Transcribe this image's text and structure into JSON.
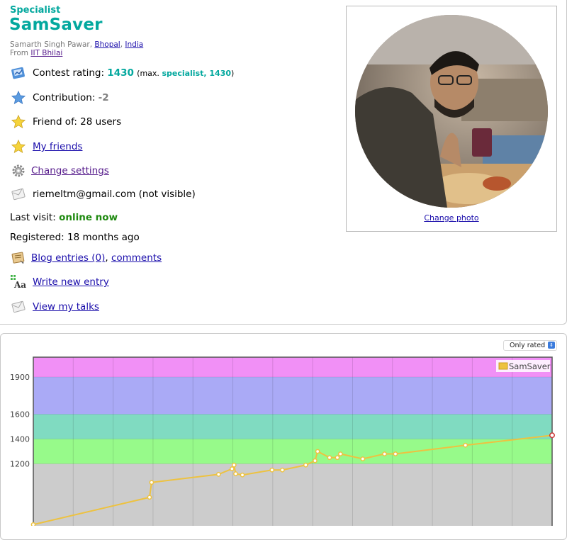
{
  "profile": {
    "rank": "Specialist",
    "handle": "SamSaver",
    "name": "Samarth Singh Pawar",
    "city": "Bhopal",
    "country": "India",
    "from_label": "From",
    "organization": "IIT Bhilai",
    "rating_label": "Contest rating:",
    "rating": "1430",
    "max_open": "(max.",
    "max_rank": "specialist, 1430",
    "max_close": ")",
    "contribution_label": "Contribution:",
    "contribution": "-2",
    "friend_of": "Friend of: 28 users",
    "my_friends": "My friends",
    "change_settings": "Change settings",
    "email": "riemeltm@gmail.com (not visible)",
    "last_visit_label": "Last visit:",
    "last_visit": "online now",
    "registered": "Registered: 18 months ago",
    "blog_entries": "Blog entries (0)",
    "comments": "comments",
    "write_entry": "Write new entry",
    "view_talks": "View my talks",
    "change_photo": "Change photo"
  },
  "graph": {
    "filter": "Only rated"
  },
  "colors": {
    "rank": "#03a89e",
    "link": "#1a0dab",
    "online": "#1f8a10",
    "line": "#edc240"
  },
  "icons": [
    "rating-icon",
    "star-icon",
    "star-icon",
    "star-icon",
    "gear-icon",
    "mail-icon",
    "blog-icon",
    "write-icon",
    "talk-icon"
  ],
  "chart_data": {
    "type": "line",
    "ylim": [
      700,
      2060
    ],
    "y_ticks": [
      1200,
      1400,
      1600,
      1900
    ],
    "bands": [
      {
        "from": 700,
        "to": 1200,
        "color": "#cccccc"
      },
      {
        "from": 1200,
        "to": 1400,
        "color": "#97fa8a"
      },
      {
        "from": 1400,
        "to": 1600,
        "color": "#80dbc1"
      },
      {
        "from": 1600,
        "to": 1900,
        "color": "#aaaaf6"
      },
      {
        "from": 1900,
        "to": 2060,
        "color": "#f190f6"
      }
    ],
    "series": [
      {
        "name": "SamSaver",
        "values": [
          710,
          930,
          1050,
          1115,
          1160,
          1190,
          1120,
          1110,
          1150,
          1150,
          1190,
          1225,
          1300,
          1250,
          1250,
          1280,
          1240,
          1280,
          1280,
          1350,
          1430
        ]
      }
    ]
  }
}
